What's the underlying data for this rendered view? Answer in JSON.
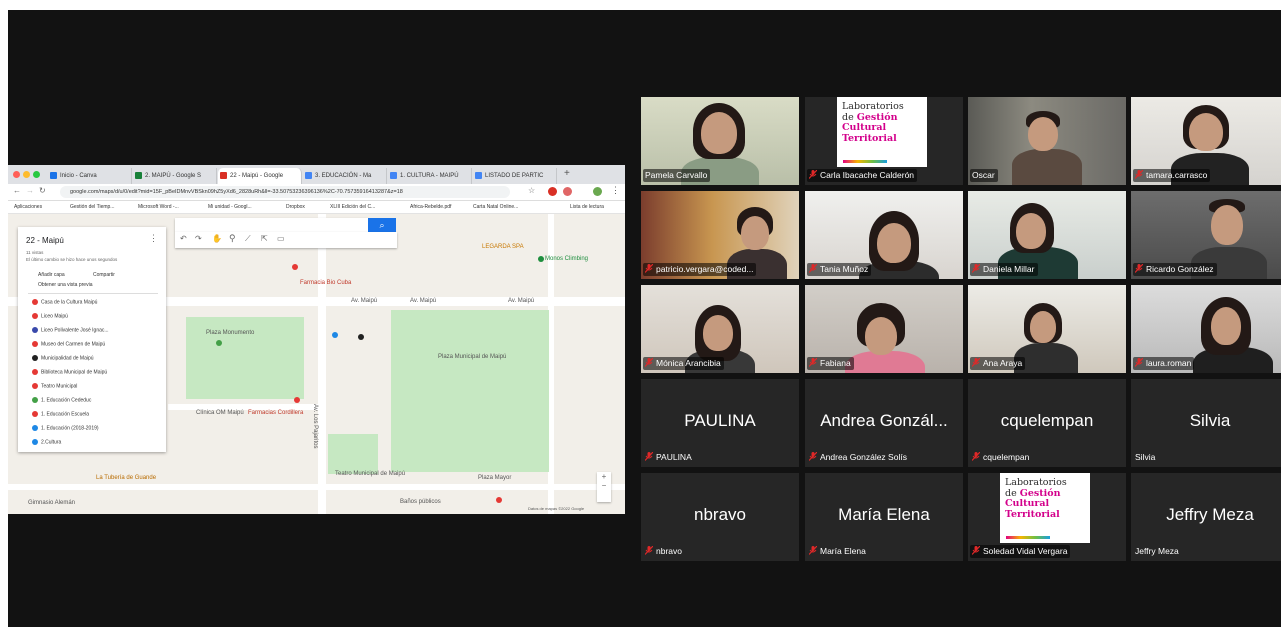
{
  "browser": {
    "tabs": [
      {
        "label": "Inicio - Canva",
        "color": "#1a73e8"
      },
      {
        "label": "2. MAIPÚ - Google S",
        "color": "#188038"
      },
      {
        "label": "22 - Maipú - Google",
        "color": "#d93025"
      },
      {
        "label": "3. EDUCACIÓN - Ma",
        "color": "#4285f4"
      },
      {
        "label": "1. CULTURA - MAIPÚ",
        "color": "#4285f4"
      },
      {
        "label": "LISTADO DE PARTIC",
        "color": "#4285f4"
      }
    ],
    "url": "google.com/maps/d/u/0/edit?mid=15F_pBeIDMnvVBSkn09hZ5yXd6_2828uRh&ll=-33.50753236396136%2C-70.75735916413287&z=18",
    "bookmarks": [
      "Aplicaciones",
      "Gestión del Tiemp...",
      "Microsoft Word -...",
      "Mi unidad - Googl...",
      "Dropbox",
      "XLIII Edición del C...",
      "Africa-Rebelde.pdf",
      "Carta Natal Online...",
      "Lista de lectura"
    ]
  },
  "map": {
    "title": "22 - Maipú",
    "views": "11 vistas",
    "last_change": "El último cambio se hizo hace unos segundos",
    "add_layer": "Añadir capa",
    "share": "Compartir",
    "preview": "Obtener una vista previa",
    "layers": [
      {
        "label": "Casa de la Cultura Maipú",
        "color": "#e53935"
      },
      {
        "label": "Liceo Maipú",
        "color": "#e53935"
      },
      {
        "label": "Liceo Polivalente José Ignac...",
        "color": "#3949ab"
      },
      {
        "label": "Museo del Carmen de Maipú",
        "color": "#e53935"
      },
      {
        "label": "Municipalidad de Maipú",
        "color": "#212121"
      },
      {
        "label": "Biblioteca Municipal de Maipú",
        "color": "#e53935"
      },
      {
        "label": "Teatro Municipal",
        "color": "#e53935"
      },
      {
        "label": "1. Educación Cededuc",
        "color": "#43a047"
      },
      {
        "label": "1. Educación Escuela",
        "color": "#e53935"
      },
      {
        "label": "1. Educación (2018-2019)",
        "color": "#1e88e5"
      },
      {
        "label": "2.Cultura",
        "color": "#1e88e5"
      }
    ],
    "labels": {
      "av_maipu_1": "Av. Maipú",
      "av_maipu_2": "Av. Maipú",
      "av_maipu_3": "Av. Maipú",
      "av_pajaritos_1": "Av. Los Pajaritos",
      "av_pajaritos_2": "Av. Los Pajaritos",
      "plaza_monumento": "Plaza Monumento",
      "plaza_municipal": "Plaza Municipal de Maipú",
      "farmacias_cordillera": "Farmacias Cordillera",
      "clinica": "Clínica OM Maipú",
      "teatro": "Teatro Municipal de Maipú",
      "plaza_mayor": "Plaza Mayor",
      "tuberia": "La Tubería de Guande",
      "gimnasio": "Gimnasio Alemán",
      "monos": "Monos Climbing",
      "legarda": "LEGARDA SPA",
      "banos": "Baños públicos",
      "farmacia_bio": "Farmacia Bio Cuba",
      "copyright": "Datos de mapas ©2022 Google"
    }
  },
  "participants": [
    {
      "name": "Pamela Carvallo",
      "speaking": true,
      "muted": false
    },
    {
      "name": "Carla Ibacache Calderón",
      "muted": true,
      "logo": true
    },
    {
      "name": "Oscar",
      "muted": false
    },
    {
      "name": "tamara.carrasco",
      "muted": true
    },
    {
      "name": "patricio.vergara@coded...",
      "muted": true
    },
    {
      "name": "Tania Muñoz",
      "muted": true
    },
    {
      "name": "Daniela Millar",
      "muted": true
    },
    {
      "name": "Ricardo González",
      "muted": true
    },
    {
      "name": "Mónica Arancibia",
      "muted": true
    },
    {
      "name": "Fabiana",
      "muted": true
    },
    {
      "name": "Ana Araya",
      "muted": true
    },
    {
      "name": "laura.roman",
      "muted": true
    },
    {
      "display": "PAULINA",
      "name": "PAULINA",
      "muted": true
    },
    {
      "display": "Andrea Gonzál...",
      "name": "Andrea González Solís",
      "muted": true
    },
    {
      "display": "cquelempan",
      "name": "cquelempan",
      "muted": true
    },
    {
      "display": "Silvia",
      "name": "Silvia",
      "muted": false
    },
    {
      "display": "nbravo",
      "name": "nbravo",
      "muted": true
    },
    {
      "display": "María Elena",
      "name": "María Elena",
      "muted": true
    },
    {
      "name": "Soledad Vidal Vergara",
      "muted": true,
      "logo": true
    },
    {
      "display": "Jeffry Meza",
      "name": "Jeffry Meza",
      "muted": false
    }
  ],
  "logo": {
    "line1": "Laboratorios",
    "line2": "de",
    "line3": "Gestión",
    "line4": "Cultural",
    "line5": "Territorial"
  },
  "colors": {
    "speaking_border": "#22c43a",
    "muted_icon": "#e02828",
    "tile_bg": "#262626",
    "background": "#121212"
  }
}
